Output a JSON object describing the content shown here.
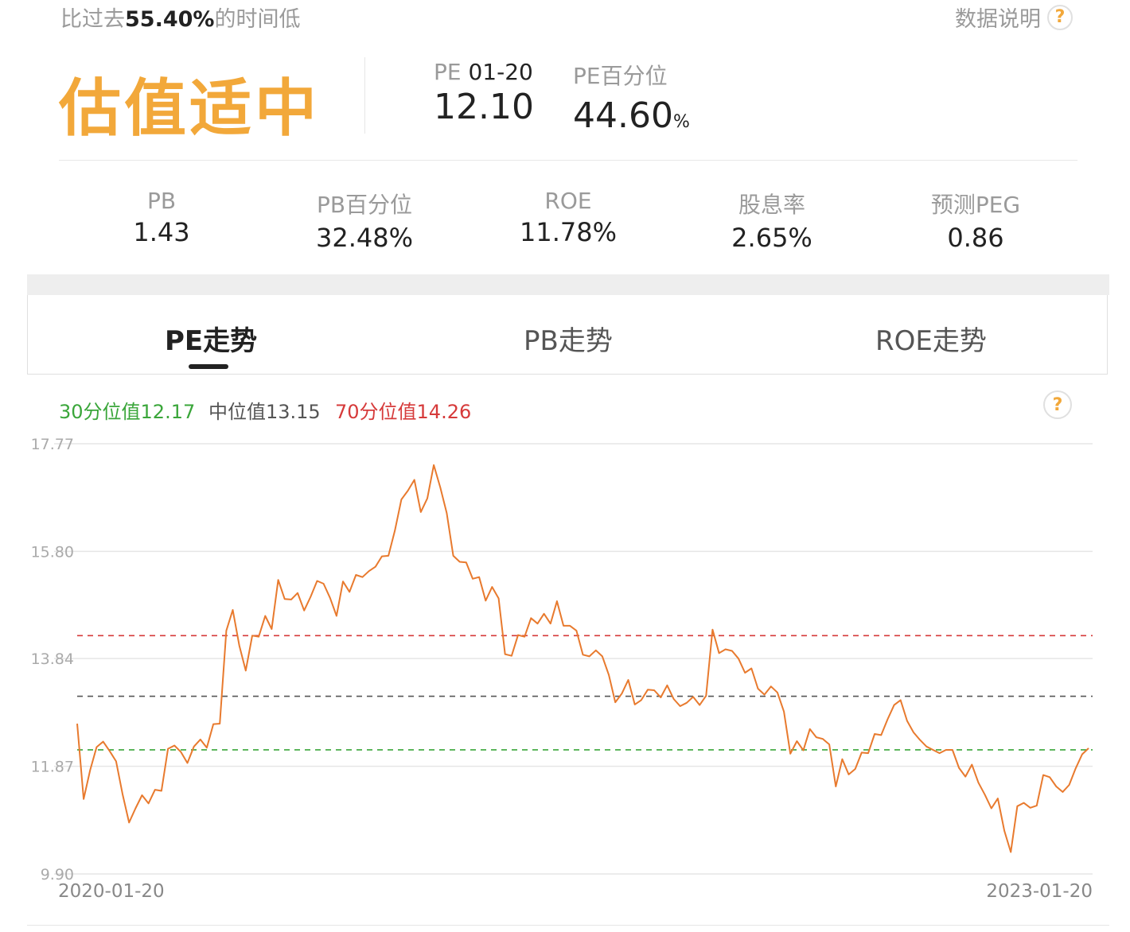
{
  "header": {
    "note_prefix": "比过去",
    "note_value": "55.40%",
    "note_suffix": "的时间低",
    "data_explain": "数据说明",
    "help_glyph": "?"
  },
  "valuation": {
    "verdict": "估值适中",
    "verdict_color": "#f2a83a",
    "pe_label": "PE",
    "pe_date": "01-20",
    "pe_value": "12.10",
    "pe_pct_label": "PE百分位",
    "pe_pct_value": "44.60",
    "pe_pct_unit": "%"
  },
  "metrics": [
    {
      "label": "PB",
      "value": "1.43"
    },
    {
      "label": "PB百分位",
      "value": "32.48%"
    },
    {
      "label": "ROE",
      "value": "11.78%"
    },
    {
      "label": "股息率",
      "value": "2.65%"
    },
    {
      "label": "预测PEG",
      "value": "0.86"
    }
  ],
  "tabs": [
    {
      "label": "PE走势",
      "active": true
    },
    {
      "label": "PB走势",
      "active": false
    },
    {
      "label": "ROE走势",
      "active": false
    }
  ],
  "legend": {
    "p30": "30分位值12.17",
    "median": "中位值13.15",
    "p70": "70分位值14.26",
    "p30_color": "#3aa63a",
    "median_color": "#555555",
    "p70_color": "#d63a3a"
  },
  "chart_data": {
    "type": "line",
    "x_start": "2020-01-20",
    "x_end": "2023-01-20",
    "ylim": [
      9.9,
      17.77
    ],
    "y_ticks": [
      "17.77",
      "15.80",
      "13.84",
      "11.87",
      "9.90"
    ],
    "reference_lines": [
      {
        "name": "70分位值",
        "value": 14.26,
        "color": "#d63a3a"
      },
      {
        "name": "中位值",
        "value": 13.15,
        "color": "#555555"
      },
      {
        "name": "30分位值",
        "value": 12.17,
        "color": "#3aa63a"
      }
    ],
    "series": [
      {
        "color": "#e87a2e",
        "values": [
          12.65,
          11.27,
          11.8,
          12.22,
          12.32,
          12.15,
          11.96,
          11.36,
          10.84,
          11.1,
          11.34,
          11.19,
          11.44,
          11.42,
          12.19,
          12.25,
          12.13,
          11.93,
          12.23,
          12.36,
          12.21,
          12.64,
          12.65,
          14.35,
          14.73,
          14.08,
          13.62,
          14.26,
          14.24,
          14.62,
          14.38,
          15.28,
          14.93,
          14.92,
          15.04,
          14.72,
          14.97,
          15.26,
          15.21,
          14.95,
          14.62,
          15.25,
          15.06,
          15.37,
          15.33,
          15.44,
          15.52,
          15.71,
          15.72,
          16.18,
          16.75,
          16.91,
          17.11,
          16.52,
          16.77,
          17.38,
          16.97,
          16.5,
          15.72,
          15.61,
          15.6,
          15.3,
          15.33,
          14.9,
          15.15,
          14.94,
          13.92,
          13.89,
          14.27,
          14.24,
          14.58,
          14.48,
          14.66,
          14.48,
          14.89,
          14.44,
          14.44,
          14.35,
          13.91,
          13.88,
          13.99,
          13.88,
          13.54,
          13.04,
          13.2,
          13.45,
          13.0,
          13.08,
          13.27,
          13.26,
          13.13,
          13.35,
          13.1,
          12.97,
          13.03,
          13.14,
          12.99,
          13.16,
          14.37,
          13.94,
          14.01,
          13.98,
          13.84,
          13.58,
          13.66,
          13.29,
          13.18,
          13.33,
          13.22,
          12.87,
          12.1,
          12.33,
          12.16,
          12.55,
          12.4,
          12.37,
          12.27,
          11.5,
          12.0,
          11.72,
          11.82,
          12.12,
          12.11,
          12.46,
          12.44,
          12.73,
          12.99,
          13.08,
          12.7,
          12.49,
          12.35,
          12.23,
          12.17,
          12.11,
          12.17,
          12.17,
          11.84,
          11.68,
          11.9,
          11.57,
          11.35,
          11.1,
          11.28,
          10.69,
          10.3,
          11.14,
          11.2,
          11.11,
          11.15,
          11.71,
          11.67,
          11.5,
          11.4,
          11.53,
          11.83,
          12.09,
          12.2
        ]
      }
    ],
    "grid": true
  }
}
